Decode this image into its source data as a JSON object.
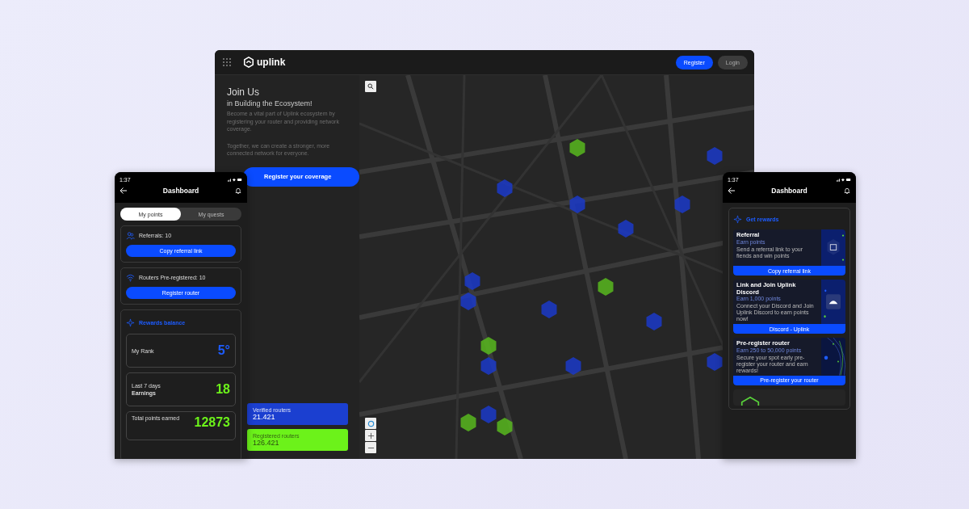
{
  "brand": "uplink",
  "desktop": {
    "nav_buttons": [
      {
        "label": "Register",
        "kind": "primary"
      },
      {
        "label": "Login",
        "kind": "secondary"
      }
    ],
    "heading": "Join Us",
    "subheading": "in Building the Ecosystem!",
    "paragraphs": [
      "Become a vital part of Uplink ecosystem by registering your router and providing network coverage.",
      "Together, we can create a stronger, more connected network for everyone."
    ],
    "cta": "Register your coverage",
    "stats": [
      {
        "label": "Verified routers",
        "value": "21.421",
        "kind": "verified"
      },
      {
        "label": "Registered routers",
        "value": "126.421",
        "kind": "registered"
      }
    ],
    "map": {
      "kind": "picture"
    }
  },
  "left_phone": {
    "time": "1:37",
    "title": "Dashboard",
    "tabs": [
      {
        "label": "My points",
        "selected": true
      },
      {
        "label": "My quests",
        "selected": false
      }
    ],
    "action_cards": [
      {
        "text": "Referrals: 10",
        "button": "Copy referral link",
        "kind": "referral"
      },
      {
        "text": "Routers Pre-registered: 10",
        "button": "Register router",
        "kind": "router"
      }
    ],
    "rewards_title": "Rewards balance",
    "stats": [
      {
        "label": "My Rank",
        "value": "5°",
        "kind": "rank"
      },
      {
        "label": "Last 7 days",
        "sublabel": "Earnings",
        "value": "18",
        "kind": "earnings"
      },
      {
        "label": "Total points earned",
        "value": "12873",
        "kind": "total"
      }
    ]
  },
  "right_phone": {
    "time": "1:37",
    "title": "Dashboard",
    "section_title": "Get rewards",
    "rewards": [
      {
        "title": "Referral",
        "subtitle": "Earn points",
        "text": "Send a referral link to your fiends and win points",
        "button": "Copy referral link",
        "kind": "gift"
      },
      {
        "title": "Link and Join Uplink Discord",
        "subtitle": "Earn 1,000 points",
        "text": "Connect your Discord and Join Uplink Discord to earn points now!",
        "button": "Discord - Uplink",
        "kind": "discord"
      },
      {
        "title": "Pre-register router",
        "subtitle": "Earn 250 to 50,000 points",
        "text": "Secure your spot early pre-register your router and earn rewards!",
        "button": "Pre-register your router",
        "kind": "orbit"
      }
    ]
  }
}
